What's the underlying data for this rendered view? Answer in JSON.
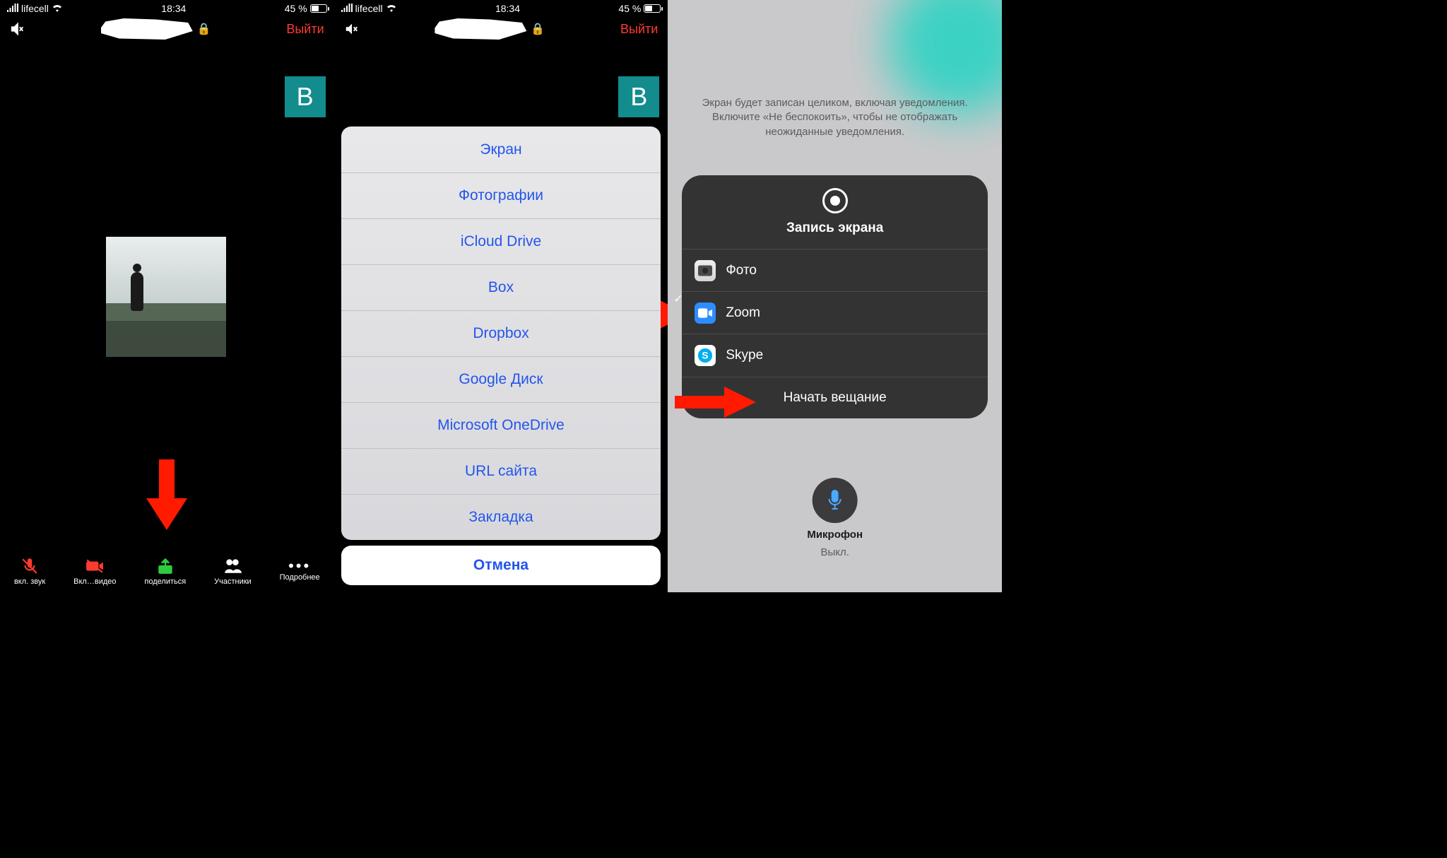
{
  "status": {
    "carrier": "lifecell",
    "time": "18:34",
    "battery_text": "45 %"
  },
  "topbar": {
    "quit": "Выйти",
    "tile_letter": "B"
  },
  "toolbar": {
    "audio": "вкл. звук",
    "video": "Вкл…видео",
    "share": "поделиться",
    "participants": "Участники",
    "more": "Подробнее"
  },
  "sheet": {
    "items": [
      "Экран",
      "Фотографии",
      "iCloud Drive",
      "Box",
      "Dropbox",
      "Google Диск",
      "Microsoft OneDrive",
      "URL сайта",
      "Закладка"
    ],
    "cancel": "Отмена"
  },
  "broadcast": {
    "notice": "Экран будет записан целиком, включая уведомления. Включите «Не беспокоить», чтобы не отображать неожиданные уведомления.",
    "title": "Запись экрана",
    "apps": [
      {
        "name": "Фото",
        "selected": false
      },
      {
        "name": "Zoom",
        "selected": true
      },
      {
        "name": "Skype",
        "selected": false
      }
    ],
    "start": "Начать вещание",
    "mic_label": "Микрофон",
    "mic_state": "Выкл."
  }
}
